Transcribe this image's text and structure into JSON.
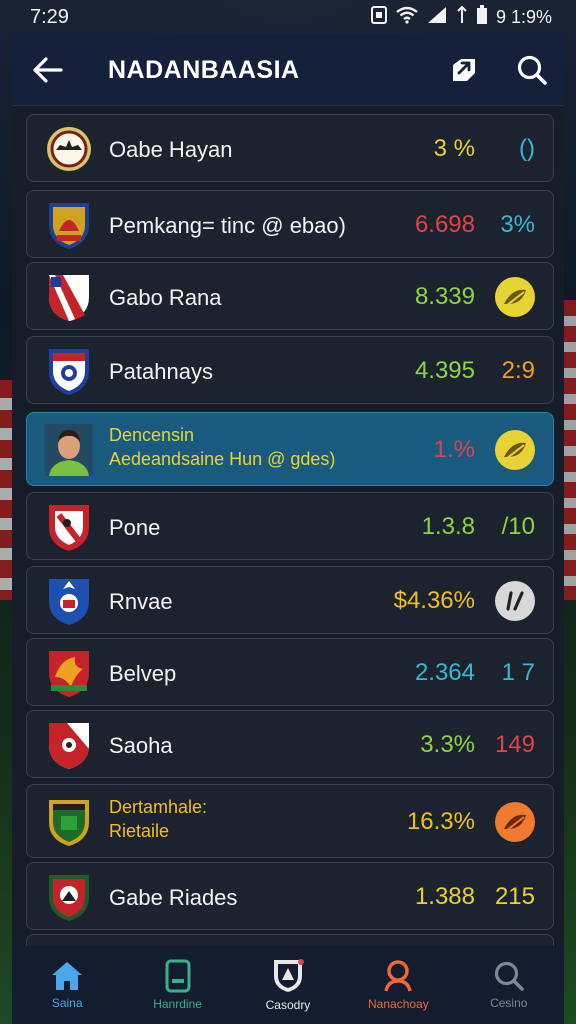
{
  "status_bar": {
    "time": "7:29",
    "battery": "9 1:9%"
  },
  "app_bar": {
    "title": "NADANBAASIA",
    "back_icon": "arrow-left-icon",
    "actions": [
      "share-icon",
      "search-icon"
    ]
  },
  "colors": {
    "header_bg": "#15203a",
    "row_bg": "#1d232e",
    "selected_row_bg": "#1a5a7e",
    "yellow": "#e8d335",
    "red": "#e0424f",
    "green": "#8fd444",
    "cyan": "#35b9d4",
    "orange": "#f0a020"
  },
  "rows": [
    {
      "name": "Oabe Hayan",
      "value": "3 %",
      "extra": "()",
      "value_color": "#e8d335",
      "extra_color": "#35b9d4"
    },
    {
      "name": "Pemkang= tinc @ ebao)",
      "value": "6.698",
      "extra": "3%",
      "value_color": "#e0424f",
      "extra_color": "#35b9d4"
    },
    {
      "name": "Gabo Rana",
      "value": "8.339",
      "value_color": "#8fd444",
      "badge_icon": "leaf-badge-icon",
      "badge_color": "#e8d335"
    },
    {
      "name": "Patahnays",
      "value": "4.395",
      "extra": "2:9",
      "value_color": "#8fd444",
      "extra_color": "#f0a020"
    },
    {
      "name": "Dencensin",
      "sub": "Aedeandsaine Hun @ gdes)",
      "value": "1.%",
      "value_color": "#e0424f",
      "badge_icon": "leaf-badge-icon",
      "badge_color": "#e8d335",
      "selected": true
    },
    {
      "name": "Pone",
      "value": "1.3.8",
      "extra": "/10",
      "value_color": "#8fd444",
      "extra_color": "#8fd444"
    },
    {
      "name": "Rnvae",
      "value": "$4.36%",
      "value_color": "#f0c020",
      "badge_icon": "slash-badge-icon",
      "badge_color": "#d8d8d8"
    },
    {
      "name": "Belvep",
      "value": "2.364",
      "extra": "1 7",
      "value_color": "#35b9d4",
      "extra_color": "#35b9d4"
    },
    {
      "name": "Saoha",
      "value": "3.3%",
      "extra": "149",
      "value_color": "#8fd444",
      "extra_color": "#e0424f"
    },
    {
      "name": "Dertamhale:",
      "sub": "Rietaile",
      "value": "16.3%",
      "value_color": "#f0c020",
      "badge_icon": "leaf-badge-icon",
      "badge_color": "#f07a30"
    },
    {
      "name": "Gabe Riades",
      "value": "1.388",
      "extra": "215",
      "value_color": "#e8d335",
      "extra_color": "#e8d335"
    }
  ],
  "bottom_nav": [
    {
      "label": "Saina",
      "icon": "home-icon",
      "color": "#4aa8e8"
    },
    {
      "label": "Hanrdine",
      "icon": "phone-icon",
      "color": "#34b38a"
    },
    {
      "label": "Casodry",
      "icon": "crest-icon",
      "color": "#e8e8e8"
    },
    {
      "label": "Nanachoay",
      "icon": "person-icon",
      "color": "#f06a30"
    },
    {
      "label": "Cesino",
      "icon": "search-icon",
      "color": "#7f8796"
    }
  ]
}
